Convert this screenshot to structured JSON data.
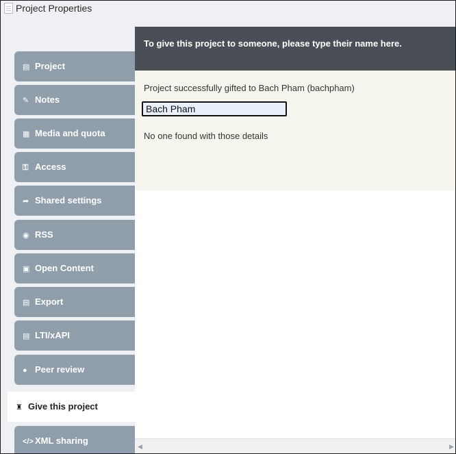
{
  "window": {
    "title": "Project Properties"
  },
  "sidebar": {
    "items": [
      {
        "label": "Project",
        "icon": "document-icon",
        "glyph": "▤"
      },
      {
        "label": "Notes",
        "icon": "edit-icon",
        "glyph": "✎"
      },
      {
        "label": "Media and quota",
        "icon": "film-icon",
        "glyph": "▦"
      },
      {
        "label": "Access",
        "icon": "unlock-icon",
        "glyph": "⚿"
      },
      {
        "label": "Shared settings",
        "icon": "share-icon",
        "glyph": "➦"
      },
      {
        "label": "RSS",
        "icon": "rss-icon",
        "glyph": "◉"
      },
      {
        "label": "Open Content",
        "icon": "cc-icon",
        "glyph": "▣"
      },
      {
        "label": "Export",
        "icon": "save-icon",
        "glyph": "▤"
      },
      {
        "label": "LTI/xAPI",
        "icon": "save-icon",
        "glyph": "▤"
      },
      {
        "label": "Peer review",
        "icon": "comments-icon",
        "glyph": "●"
      },
      {
        "label": "Give this project",
        "icon": "gift-icon",
        "glyph": "♜",
        "active": true
      },
      {
        "label": "XML sharing",
        "icon": "code-icon",
        "glyph": "</>"
      }
    ]
  },
  "main": {
    "header": "To give this project to someone, please type their name here.",
    "success_message": "Project successfully gifted to Bach Pham (bachpham)",
    "name_input_value": "Bach Pham",
    "no_result_message": "No one found with those details"
  },
  "colors": {
    "tab_bg": "#8f9eaa",
    "header_bg": "#4a4e55",
    "form_bg": "#f7f6ee",
    "input_bg": "#e9f0fb"
  }
}
